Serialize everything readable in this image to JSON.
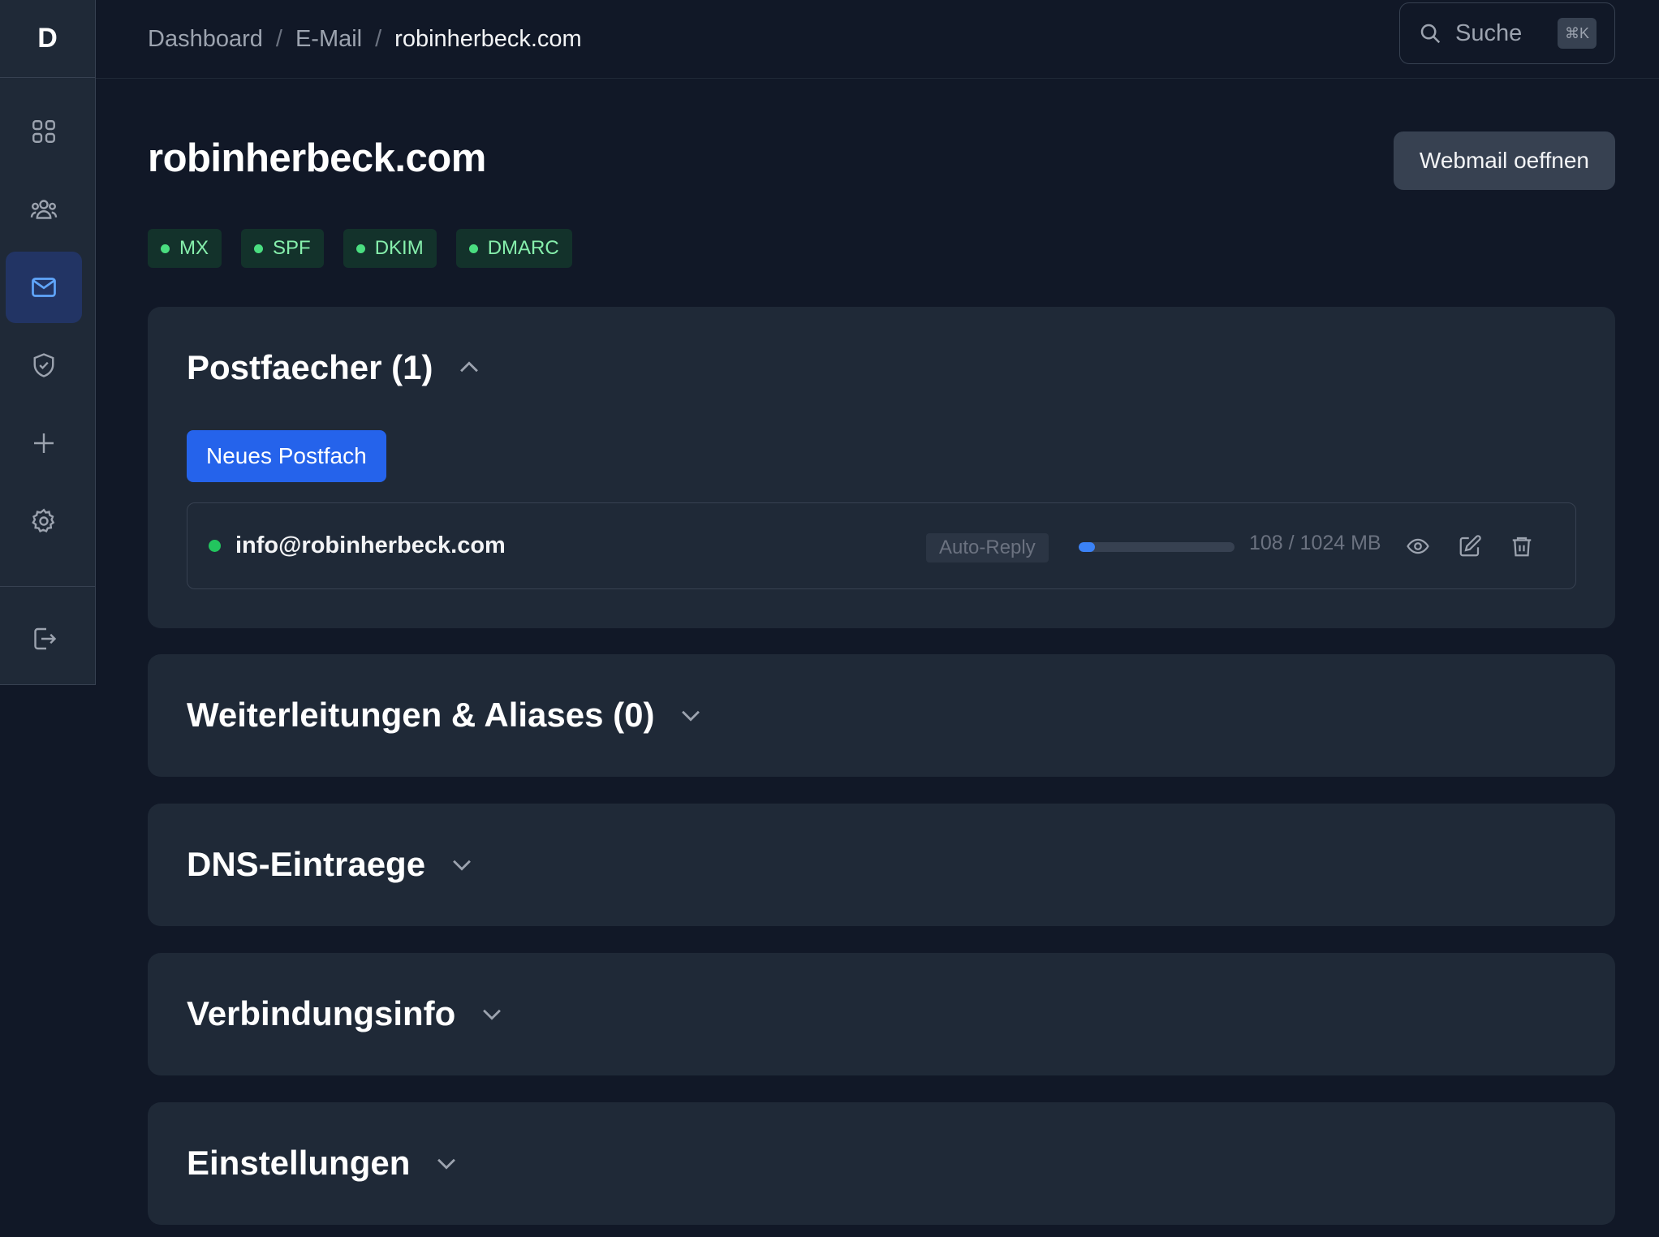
{
  "sidebar": {
    "logo": "D",
    "items": [
      {
        "name": "grid-icon"
      },
      {
        "name": "users-icon"
      },
      {
        "name": "mail-icon",
        "active": true
      },
      {
        "name": "shield-icon"
      },
      {
        "name": "plus-icon"
      },
      {
        "name": "gear-icon"
      }
    ],
    "logout": {
      "name": "logout-icon"
    }
  },
  "breadcrumb": {
    "items": [
      "Dashboard",
      "E-Mail"
    ],
    "current": "robinherbeck.com",
    "separator": "/"
  },
  "search": {
    "label": "Suche",
    "shortcut": "⌘K"
  },
  "page": {
    "title": "robinherbeck.com",
    "webmail_button": "Webmail oeffnen"
  },
  "dns_badges": [
    "MX",
    "SPF",
    "DKIM",
    "DMARC"
  ],
  "sections": {
    "mailboxes": {
      "title": "Postfaecher (1)",
      "expanded": true,
      "new_button": "Neues Postfach",
      "items": [
        {
          "address": "info@robinherbeck.com",
          "badge": "Auto-Reply",
          "quota_used": 108,
          "quota_total": 1024,
          "quota_text": "108 / 1024 MB"
        }
      ]
    },
    "forwards": {
      "title": "Weiterleitungen & Aliases (0)",
      "expanded": false
    },
    "dns": {
      "title": "DNS-Eintraege",
      "expanded": false
    },
    "connection": {
      "title": "Verbindungsinfo",
      "expanded": false
    },
    "settings": {
      "title": "Einstellungen",
      "expanded": false
    }
  },
  "colors": {
    "background": "#111827",
    "card": "#1f2937",
    "accent": "#2563eb",
    "success": "#22c55e"
  }
}
